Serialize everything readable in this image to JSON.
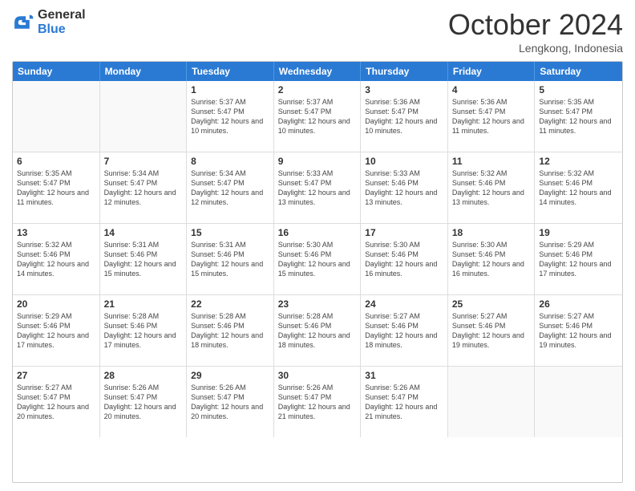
{
  "logo": {
    "general": "General",
    "blue": "Blue"
  },
  "header": {
    "month": "October 2024",
    "location": "Lengkong, Indonesia"
  },
  "days": [
    "Sunday",
    "Monday",
    "Tuesday",
    "Wednesday",
    "Thursday",
    "Friday",
    "Saturday"
  ],
  "rows": [
    [
      {
        "day": "",
        "info": "",
        "empty": true
      },
      {
        "day": "",
        "info": "",
        "empty": true
      },
      {
        "day": "1",
        "info": "Sunrise: 5:37 AM\nSunset: 5:47 PM\nDaylight: 12 hours and 10 minutes."
      },
      {
        "day": "2",
        "info": "Sunrise: 5:37 AM\nSunset: 5:47 PM\nDaylight: 12 hours and 10 minutes."
      },
      {
        "day": "3",
        "info": "Sunrise: 5:36 AM\nSunset: 5:47 PM\nDaylight: 12 hours and 10 minutes."
      },
      {
        "day": "4",
        "info": "Sunrise: 5:36 AM\nSunset: 5:47 PM\nDaylight: 12 hours and 11 minutes."
      },
      {
        "day": "5",
        "info": "Sunrise: 5:35 AM\nSunset: 5:47 PM\nDaylight: 12 hours and 11 minutes."
      }
    ],
    [
      {
        "day": "6",
        "info": "Sunrise: 5:35 AM\nSunset: 5:47 PM\nDaylight: 12 hours and 11 minutes."
      },
      {
        "day": "7",
        "info": "Sunrise: 5:34 AM\nSunset: 5:47 PM\nDaylight: 12 hours and 12 minutes."
      },
      {
        "day": "8",
        "info": "Sunrise: 5:34 AM\nSunset: 5:47 PM\nDaylight: 12 hours and 12 minutes."
      },
      {
        "day": "9",
        "info": "Sunrise: 5:33 AM\nSunset: 5:47 PM\nDaylight: 12 hours and 13 minutes."
      },
      {
        "day": "10",
        "info": "Sunrise: 5:33 AM\nSunset: 5:46 PM\nDaylight: 12 hours and 13 minutes."
      },
      {
        "day": "11",
        "info": "Sunrise: 5:32 AM\nSunset: 5:46 PM\nDaylight: 12 hours and 13 minutes."
      },
      {
        "day": "12",
        "info": "Sunrise: 5:32 AM\nSunset: 5:46 PM\nDaylight: 12 hours and 14 minutes."
      }
    ],
    [
      {
        "day": "13",
        "info": "Sunrise: 5:32 AM\nSunset: 5:46 PM\nDaylight: 12 hours and 14 minutes."
      },
      {
        "day": "14",
        "info": "Sunrise: 5:31 AM\nSunset: 5:46 PM\nDaylight: 12 hours and 15 minutes."
      },
      {
        "day": "15",
        "info": "Sunrise: 5:31 AM\nSunset: 5:46 PM\nDaylight: 12 hours and 15 minutes."
      },
      {
        "day": "16",
        "info": "Sunrise: 5:30 AM\nSunset: 5:46 PM\nDaylight: 12 hours and 15 minutes."
      },
      {
        "day": "17",
        "info": "Sunrise: 5:30 AM\nSunset: 5:46 PM\nDaylight: 12 hours and 16 minutes."
      },
      {
        "day": "18",
        "info": "Sunrise: 5:30 AM\nSunset: 5:46 PM\nDaylight: 12 hours and 16 minutes."
      },
      {
        "day": "19",
        "info": "Sunrise: 5:29 AM\nSunset: 5:46 PM\nDaylight: 12 hours and 17 minutes."
      }
    ],
    [
      {
        "day": "20",
        "info": "Sunrise: 5:29 AM\nSunset: 5:46 PM\nDaylight: 12 hours and 17 minutes."
      },
      {
        "day": "21",
        "info": "Sunrise: 5:28 AM\nSunset: 5:46 PM\nDaylight: 12 hours and 17 minutes."
      },
      {
        "day": "22",
        "info": "Sunrise: 5:28 AM\nSunset: 5:46 PM\nDaylight: 12 hours and 18 minutes."
      },
      {
        "day": "23",
        "info": "Sunrise: 5:28 AM\nSunset: 5:46 PM\nDaylight: 12 hours and 18 minutes."
      },
      {
        "day": "24",
        "info": "Sunrise: 5:27 AM\nSunset: 5:46 PM\nDaylight: 12 hours and 18 minutes."
      },
      {
        "day": "25",
        "info": "Sunrise: 5:27 AM\nSunset: 5:46 PM\nDaylight: 12 hours and 19 minutes."
      },
      {
        "day": "26",
        "info": "Sunrise: 5:27 AM\nSunset: 5:46 PM\nDaylight: 12 hours and 19 minutes."
      }
    ],
    [
      {
        "day": "27",
        "info": "Sunrise: 5:27 AM\nSunset: 5:47 PM\nDaylight: 12 hours and 20 minutes."
      },
      {
        "day": "28",
        "info": "Sunrise: 5:26 AM\nSunset: 5:47 PM\nDaylight: 12 hours and 20 minutes."
      },
      {
        "day": "29",
        "info": "Sunrise: 5:26 AM\nSunset: 5:47 PM\nDaylight: 12 hours and 20 minutes."
      },
      {
        "day": "30",
        "info": "Sunrise: 5:26 AM\nSunset: 5:47 PM\nDaylight: 12 hours and 21 minutes."
      },
      {
        "day": "31",
        "info": "Sunrise: 5:26 AM\nSunset: 5:47 PM\nDaylight: 12 hours and 21 minutes."
      },
      {
        "day": "",
        "info": "",
        "empty": true
      },
      {
        "day": "",
        "info": "",
        "empty": true
      }
    ]
  ]
}
